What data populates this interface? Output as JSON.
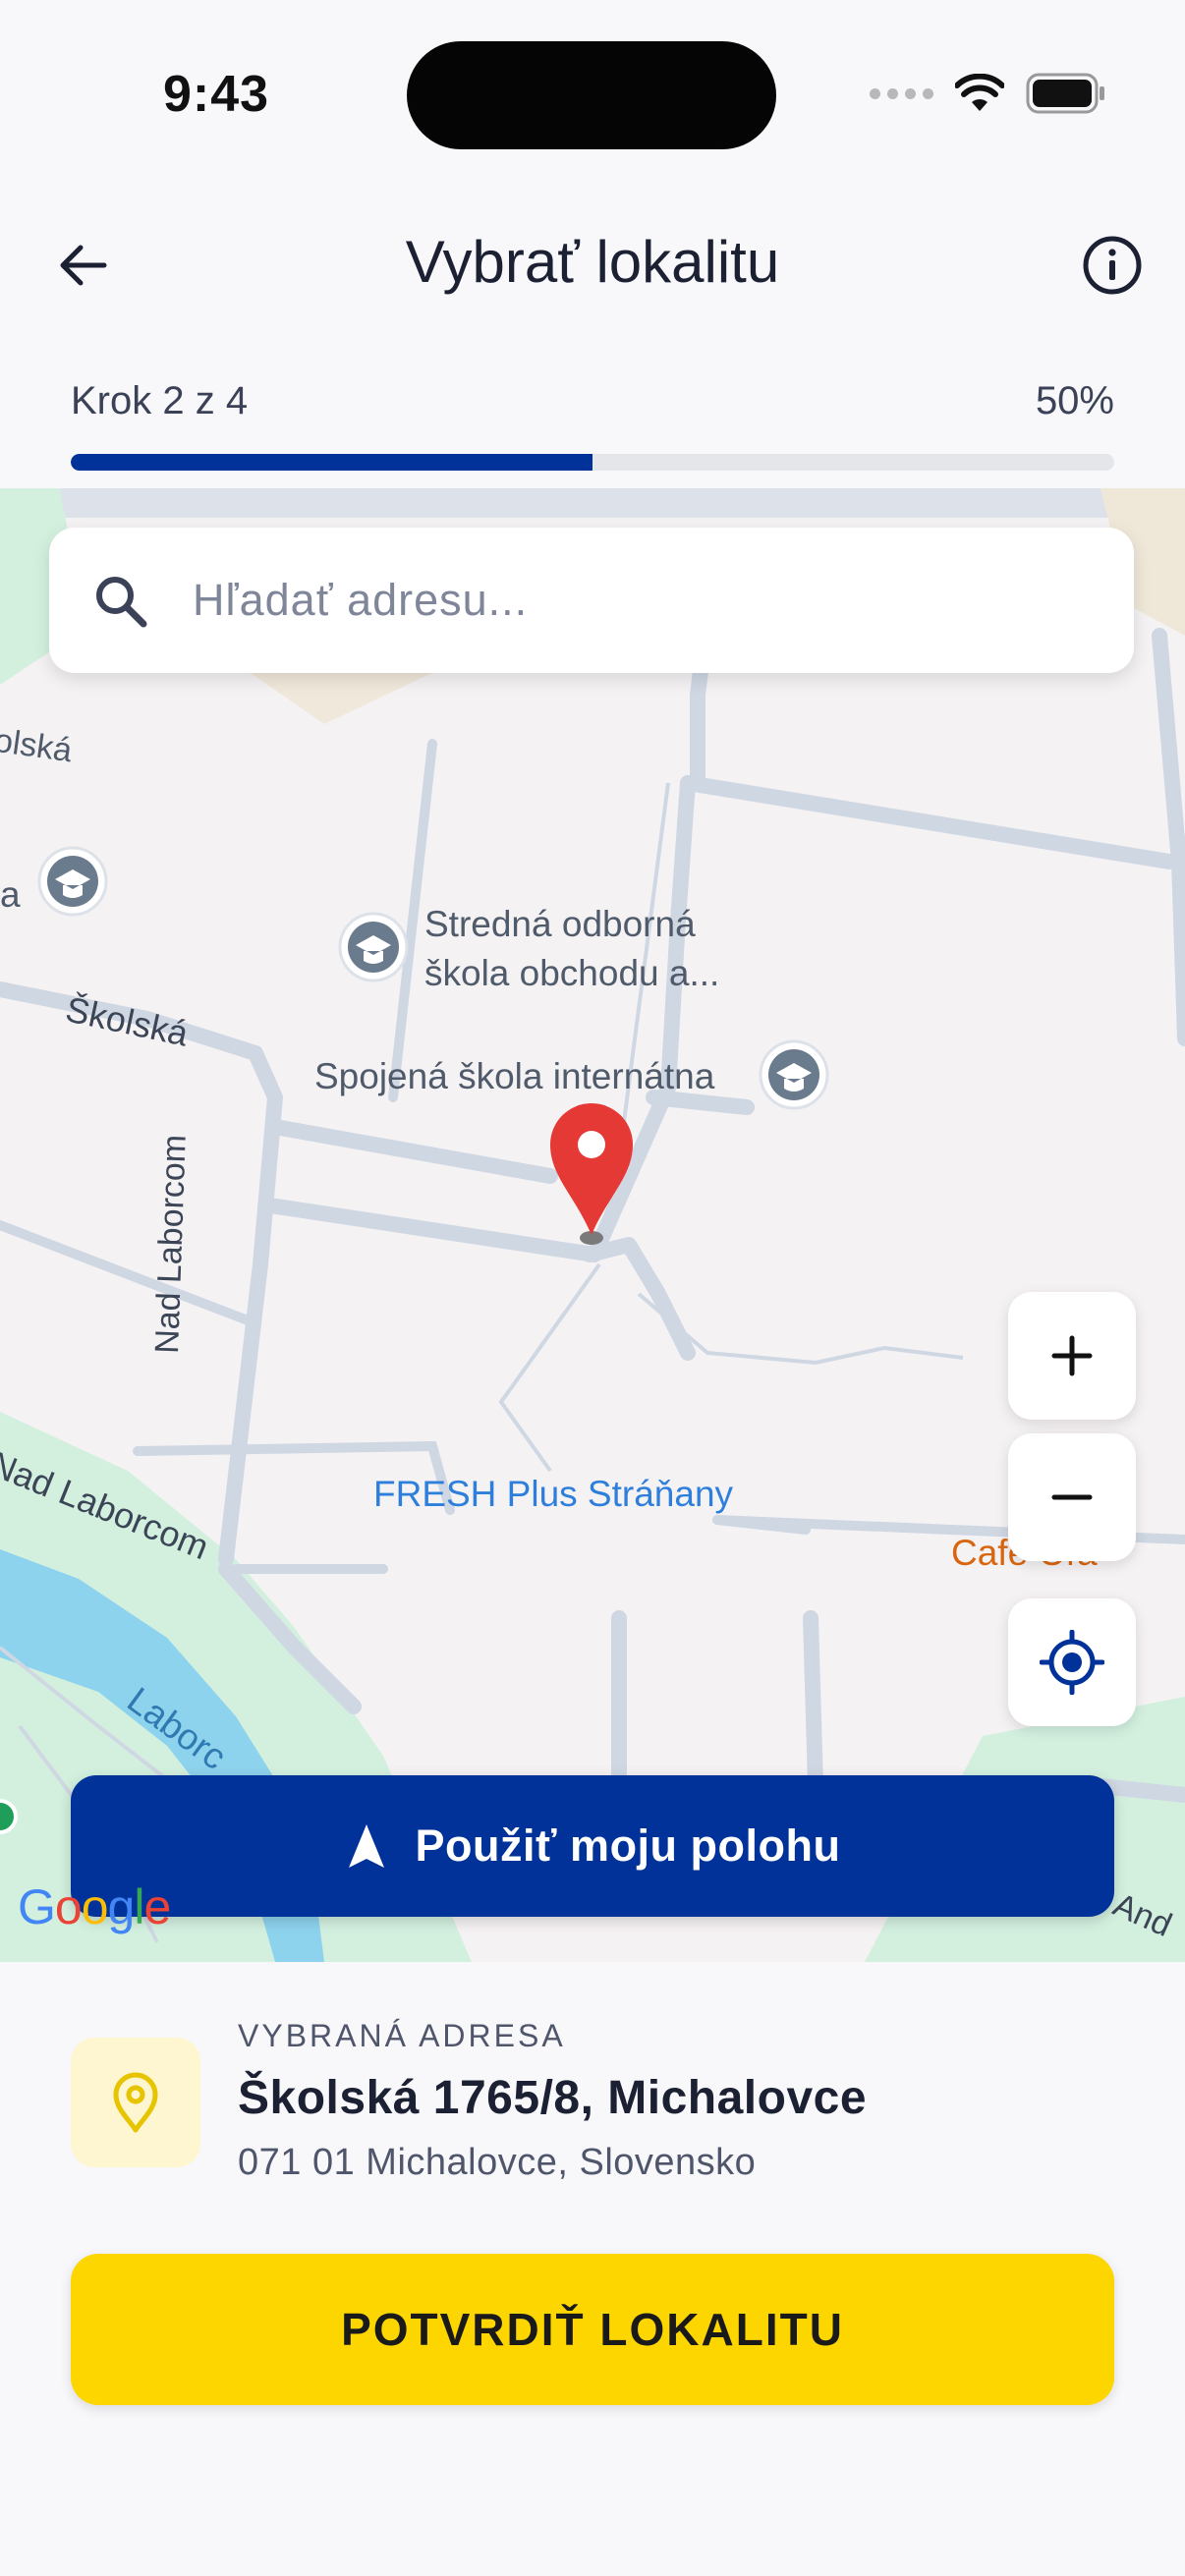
{
  "status_bar": {
    "time": "9:43"
  },
  "header": {
    "title": "Vybrať lokalitu"
  },
  "progress": {
    "label": "Krok 2 z 4",
    "percent_text": "50%",
    "fraction": 0.5,
    "color": "#00329a"
  },
  "search": {
    "placeholder": "Hľadať adresu..."
  },
  "map": {
    "street_labels": [
      "Školská",
      "olská",
      "Nad Laborcom",
      "Nad Laborcom",
      "Laborc",
      "And"
    ],
    "poi_labels": [
      "Stredná odborná",
      "škola obchodu a...",
      "Spojená škola internátna",
      "FRESH Plus Stráňany",
      "Cafe Oľa",
      "a"
    ],
    "attribution": "Google"
  },
  "controls": {
    "zoom_in": "+",
    "zoom_out": "−"
  },
  "use_location_button": {
    "label": "Použiť moju polohu"
  },
  "selected_address": {
    "caption": "VYBRANÁ ADRESA",
    "street": "Školská 1765/8, Michalovce",
    "city": "071 01 Michalovce, Slovensko"
  },
  "confirm_button": {
    "label": "POTVRDIŤ LOKALITU"
  },
  "colors": {
    "brand_blue": "#00329a",
    "accent_yellow": "#fdd600",
    "pin_red": "#e53935"
  }
}
